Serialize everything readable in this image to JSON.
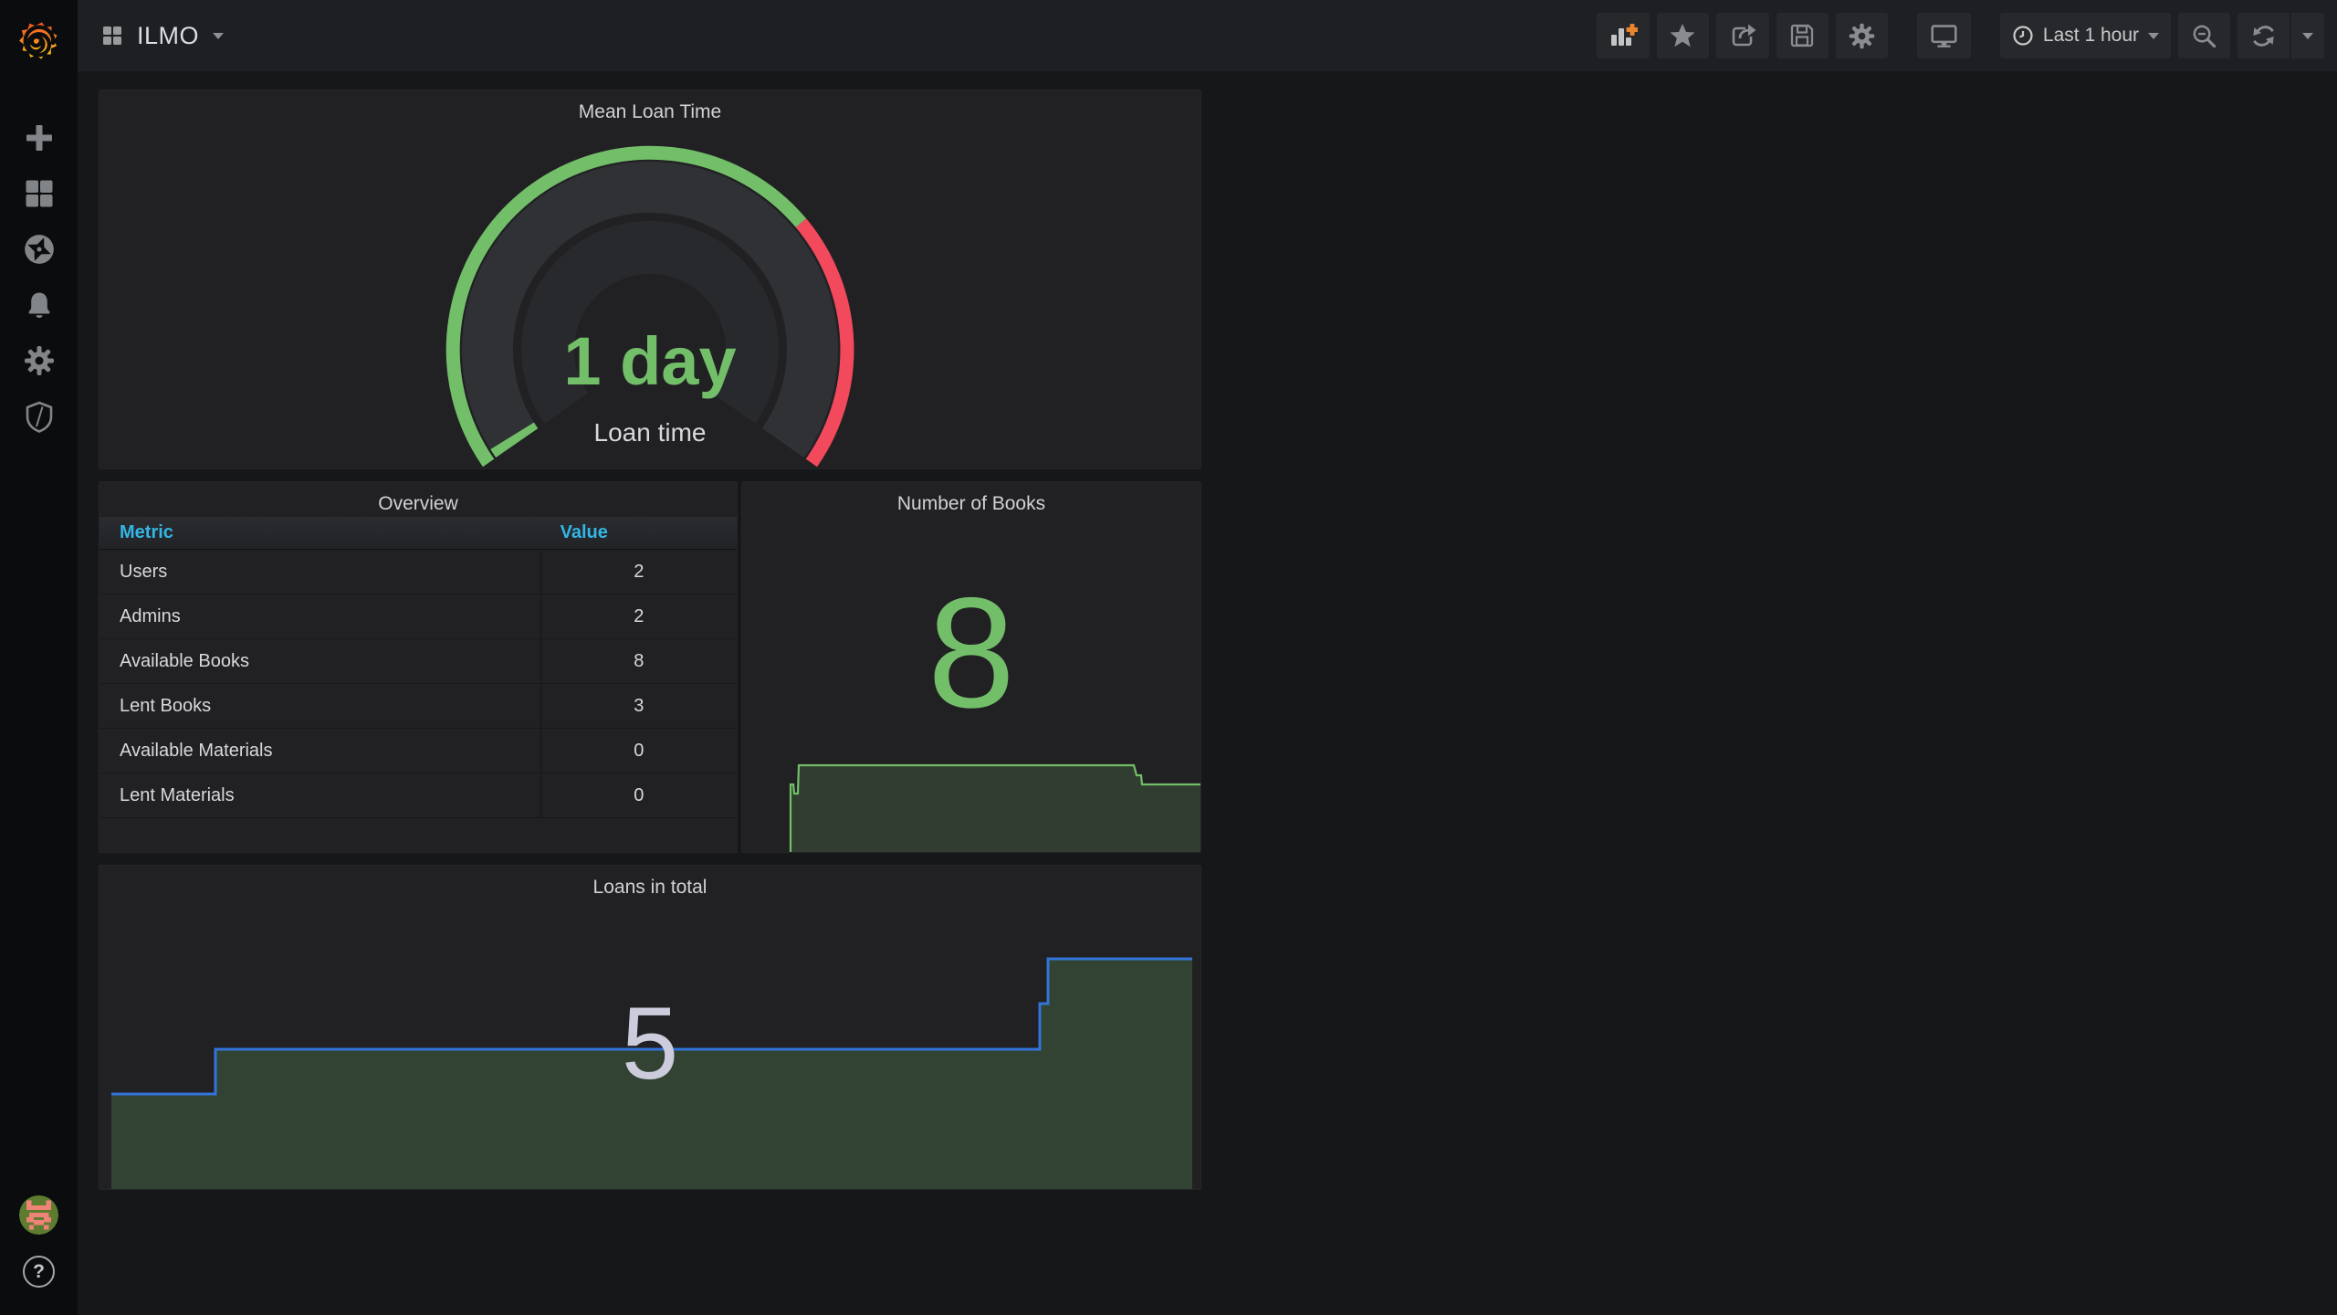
{
  "topbar": {
    "title": "ILMO",
    "time_range_label": "Last 1 hour",
    "buttons": [
      "add-panel",
      "mark-as-favorite",
      "share-dashboard",
      "save-dashboard",
      "dashboard-settings",
      "cycle-view-mode",
      "time-range-picker",
      "zoom-out-time-range",
      "refresh-dashboard",
      "refresh-interval-picker"
    ]
  },
  "sidebar": {
    "items": [
      "create",
      "dashboards",
      "explore",
      "alerting",
      "configuration",
      "server-admin"
    ],
    "help_glyph": "?"
  },
  "panels": {
    "gauge": {
      "title": "Mean Loan Time",
      "value_text": "1 day",
      "label": "Loan time"
    },
    "overview": {
      "title": "Overview",
      "columns": [
        "Metric",
        "Value"
      ],
      "rows": [
        [
          "Users",
          "2"
        ],
        [
          "Admins",
          "2"
        ],
        [
          "Available Books",
          "8"
        ],
        [
          "Lent Books",
          "3"
        ],
        [
          "Available Materials",
          "0"
        ],
        [
          "Lent Materials",
          "0"
        ]
      ]
    },
    "books": {
      "title": "Number of Books",
      "value_text": "8"
    },
    "loans": {
      "title": "Loans in total",
      "value_text": "5"
    }
  },
  "colors": {
    "green": "#73BF69",
    "red": "#F2495C",
    "line_blue": "#3274D9",
    "header_blue": "#33B5E5",
    "panel_bg": "#212124",
    "page_bg": "#161719"
  },
  "chart_data": [
    {
      "type": "gauge",
      "title": "Mean Loan Time",
      "value": "1 day",
      "label": "Loan time",
      "value_color": "#73BF69",
      "threshold_colors": [
        "#73BF69",
        "#F2495C"
      ],
      "threshold_split_fraction": 0.73,
      "value_fraction": 0.02,
      "arc_start_deg": 215,
      "arc_end_deg": -35
    },
    {
      "type": "table",
      "title": "Overview",
      "columns": [
        "Metric",
        "Value"
      ],
      "rows": [
        [
          "Users",
          2
        ],
        [
          "Admins",
          2
        ],
        [
          "Available Books",
          8
        ],
        [
          "Lent Books",
          3
        ],
        [
          "Available Materials",
          0
        ],
        [
          "Lent Materials",
          0
        ]
      ]
    },
    {
      "type": "area",
      "title": "Number of Books",
      "current": 8,
      "line_color": "#73BF69",
      "legend_position": "none",
      "grid": false,
      "series": [
        {
          "name": "books",
          "points_xfrac_value": [
            [
              0.105,
              0
            ],
            [
              0.105,
              7
            ],
            [
              0.112,
              7
            ],
            [
              0.113,
              6
            ],
            [
              0.121,
              6
            ],
            [
              0.123,
              8
            ],
            [
              0.851,
              8
            ],
            [
              0.857,
              7.5
            ],
            [
              0.867,
              7.5
            ],
            [
              0.869,
              7
            ],
            [
              0.996,
              7
            ]
          ]
        }
      ]
    },
    {
      "type": "area",
      "title": "Loans in total",
      "current": 5,
      "line_color": "#3274D9",
      "legend_position": "none",
      "grid": false,
      "series": [
        {
          "name": "loans",
          "points_xfrac_value": [
            [
              0.011,
              2
            ],
            [
              0.105,
              2
            ],
            [
              0.105,
              3
            ],
            [
              0.853,
              3
            ],
            [
              0.853,
              4
            ],
            [
              0.86,
              4
            ],
            [
              0.86,
              5
            ],
            [
              0.991,
              5
            ]
          ]
        }
      ]
    }
  ]
}
